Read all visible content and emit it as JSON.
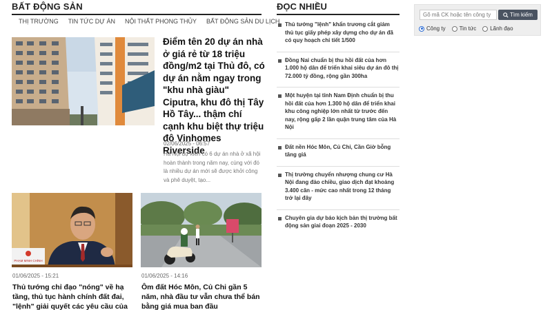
{
  "section": {
    "title": "BẤT ĐỘNG SẢN",
    "tabs": [
      "THỊ TRƯỜNG",
      "TIN TỨC DỰ ÁN",
      "NỘI THẤT PHONG THỦY",
      "BẤT ĐỘNG SẢN DU LỊCH"
    ]
  },
  "hero": {
    "title": "Điểm tên 20 dự án nhà ở giá rẻ từ 18 triệu đồng/m2 tại Thủ đô, có dự án nằm ngay trong \"khu nhà giàu\" Ciputra, khu đô thị Tây Hồ Tây... thậm chí cạnh khu biệt thự triệu đô Vinhomes Riverside",
    "time": "02/06/2025 - 06:57",
    "desc": "Hà Nội dự kiến có 6 dự án nhà ở xã hội hoàn thành trong năm nay, cùng với đó là nhiều dự án mới sẽ được khởi công và phê duyệt, tạo..."
  },
  "cards": [
    {
      "time": "01/06/2025 - 15:21",
      "title": "Thủ tướng chỉ đạo \"nóng\" về hạ tầng, thủ tục hành chính đất đai, \"lệnh\" giải quyết các yêu cầu của doanh nghiệp",
      "nameplate": "PHẠM MINH CHÍNH"
    },
    {
      "time": "01/06/2025 - 14:16",
      "title": "Ôm đất Hóc Môn, Củ Chi gần 5 năm, nhà đầu tư vẫn chưa thể bán bằng giá mua ban đầu"
    }
  ],
  "most_read": {
    "title": "ĐỌC NHIỀU",
    "items": [
      "Thủ tướng \"lệnh\" khẩn trương cắt giảm thủ tục giấy phép xây dựng cho dự án đã có quy hoạch chi tiết 1/500",
      "Đồng Nai chuẩn bị thu hồi đất của hơn 1.000 hộ dân để triển khai siêu dự án đô thị 72.000 tỷ đồng, rộng gần 300ha",
      "Một huyện tại tỉnh Nam Định chuẩn bị thu hồi đất của hơn 1.300 hộ dân để triển khai khu công nghiệp lớn nhất từ trước đến nay, rộng gấp 2 lần quận trung tâm của Hà Nội",
      "Đất nền Hóc Môn, Củ Chi, Cần Giờ bỗng tăng giá",
      "Thị trường chuyển nhượng chung cư Hà Nội đang đảo chiều, giao dịch đạt khoảng 3.400 căn - mức cao nhất trong 12 tháng trở lại đây",
      "Chuyên gia dự báo kịch bản thị trường bất động sản giai đoạn 2025 - 2030"
    ]
  },
  "search": {
    "placeholder": "Gõ mã CK hoặc tên công ty",
    "button_label": "Tìm kiếm",
    "options": [
      "Công ty",
      "Tin tức",
      "Lãnh đạo"
    ],
    "selected": "Công ty"
  }
}
